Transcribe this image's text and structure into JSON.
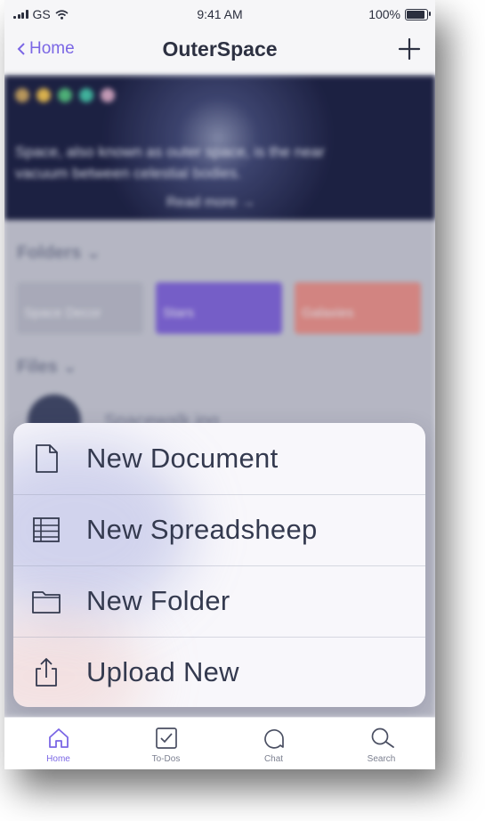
{
  "status_bar": {
    "carrier": "GS",
    "time": "9:41 AM",
    "battery": "100%",
    "battery_level": 1.0
  },
  "nav": {
    "back_label": "Home",
    "title": "OuterSpace",
    "add_icon": "plus-icon"
  },
  "hero": {
    "text_line1": "Space, also known as outer space, is the near",
    "text_line2": "vacuum between celestial bodies.",
    "cta": "Read more →",
    "dot_colors": [
      "#caa35a",
      "#f0c14a",
      "#4ec07a",
      "#3fc3a4",
      "#d7a7c2"
    ]
  },
  "folders": {
    "title": "Folders ⌄",
    "items": [
      {
        "label": "Space Decor",
        "color": "#b8bac6"
      },
      {
        "label": "Stars",
        "color": "#7d62d8"
      },
      {
        "label": "Galaxies",
        "color": "#e98f86"
      }
    ]
  },
  "files": {
    "title": "Files ⌄",
    "first_file": "Spacewalk.jpg"
  },
  "menu": {
    "items": [
      {
        "label": "New Document",
        "icon": "document-icon"
      },
      {
        "label": "New Spreadsheep",
        "icon": "spreadsheet-icon"
      },
      {
        "label": "New Folder",
        "icon": "folder-icon"
      },
      {
        "label": "Upload New",
        "icon": "upload-icon"
      }
    ]
  },
  "tabs": [
    {
      "label": "Home",
      "icon": "home-icon",
      "active": true
    },
    {
      "label": "To-Dos",
      "icon": "checkbox-icon",
      "active": false
    },
    {
      "label": "Chat",
      "icon": "chat-icon",
      "active": false
    },
    {
      "label": "Search",
      "icon": "search-icon",
      "active": false
    }
  ],
  "colors": {
    "accent": "#7b67e5",
    "text": "#343a4f"
  }
}
